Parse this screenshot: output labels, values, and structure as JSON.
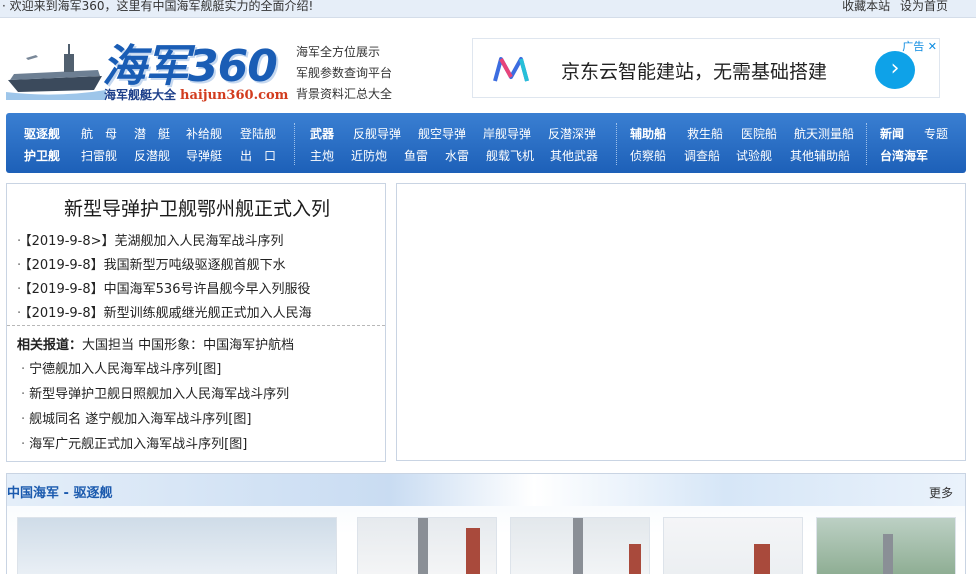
{
  "topbar": {
    "welcome": "· 欢迎来到海军360，这里有中国海军舰艇实力的全面介绍!",
    "bookmark": "收藏本站",
    "homepage": "设为首页"
  },
  "logo": {
    "brand": "海军360",
    "subtitle": "海军舰艇大全",
    "domain": "haijun360.com"
  },
  "slogans": [
    "海军全方位展示",
    "军舰参数查询平台",
    "背景资料汇总大全"
  ],
  "ad": {
    "text": "京东云智能建站，无需基础搭建",
    "mark": "广告",
    "close_icon": "close-icon",
    "go_icon": "chevron-right-icon",
    "accent": "#0ea2e8"
  },
  "nav": {
    "g1": {
      "row1": [
        "驱逐舰",
        "航　母",
        "潜　艇",
        "补给舰",
        "登陆舰"
      ],
      "row2": [
        "护卫舰",
        "扫雷舰",
        "反潜舰",
        "导弹艇",
        "出　口"
      ]
    },
    "g2": {
      "row1": [
        "武器",
        "反舰导弹",
        "舰空导弹",
        "岸舰导弹",
        "反潜深弹"
      ],
      "row2": [
        "主炮",
        "近防炮",
        "鱼雷",
        "水雷",
        "舰载飞机",
        "其他武器"
      ]
    },
    "g3": {
      "row1": [
        "辅助船",
        "救生船",
        "医院船",
        "航天测量船"
      ],
      "row2": [
        "侦察船",
        "调查船",
        "试验舰",
        "其他辅助船"
      ]
    },
    "g4": {
      "row1": [
        "新闻",
        "专题"
      ],
      "row2": [
        "台湾海军"
      ]
    },
    "color": "#2a6fc6"
  },
  "main": {
    "headline": "新型导弹护卫舰鄂州舰正式入列",
    "news": [
      "【2019-9-8>】芜湖舰加入人民海军战斗序列",
      "【2019-9-8】我国新型万吨级驱逐舰首舰下水",
      "【2019-9-8】中国海军536号许昌舰今早入列服役",
      "【2019-9-8】新型训练舰戚继光舰正式加入人民海"
    ],
    "related_label": "相关报道：",
    "related_inline": "大国担当  中国形象：中国海军护航档",
    "related": [
      "宁德舰加入人民海军战斗序列[图]",
      "新型导弹护卫舰日照舰加入人民海军战斗序列",
      "舰城同名  遂宁舰加入海军战斗序列[图]",
      "海军广元舰正式加入海军战斗序列[图]"
    ]
  },
  "section": {
    "title": "中国海军 - 驱逐舰",
    "more": "更多"
  }
}
